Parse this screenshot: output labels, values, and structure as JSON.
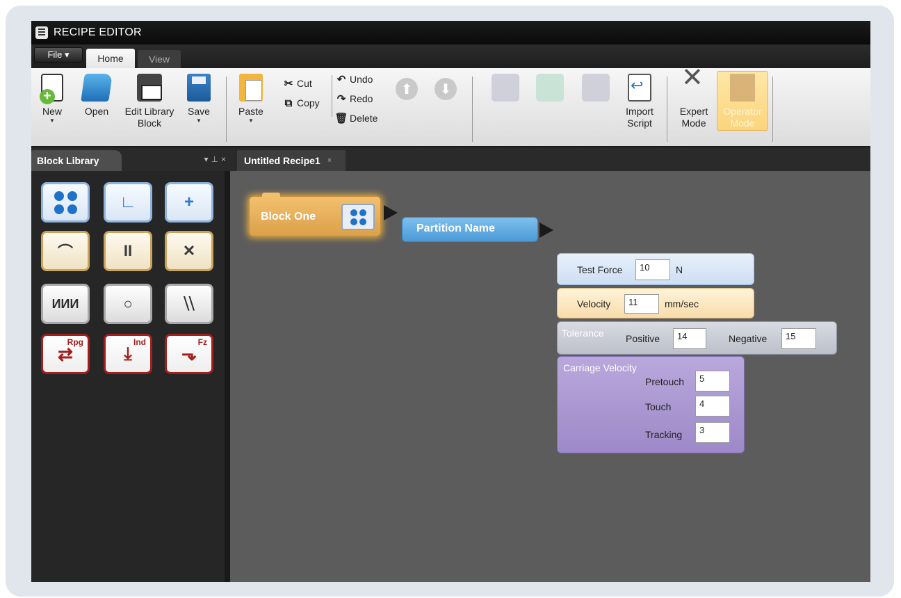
{
  "window": {
    "title": "RECIPE EDITOR"
  },
  "menu": {
    "file": "File ▾",
    "tabs": [
      "Home",
      "View"
    ]
  },
  "ribbon": {
    "new": "New",
    "open": "Open",
    "edit_library_block": "Edit Library Block",
    "save": "Save",
    "paste": "Paste",
    "cut": "Cut",
    "copy": "Copy",
    "undo": "Undo",
    "redo": "Redo",
    "delete": "Delete",
    "import_script": "Import Script",
    "expert_mode": "Expert Mode",
    "operator_mode": "Operator Mode"
  },
  "library": {
    "title": "Block Library"
  },
  "document": {
    "tab": "Untitled Recipe1"
  },
  "blocks": {
    "block_one": "Block One",
    "partition_name": "Partition Name",
    "test_force": {
      "label": "Test Force",
      "value": "10",
      "unit": "N"
    },
    "velocity": {
      "label": "Velocity",
      "value": "11",
      "unit": "mm/sec"
    },
    "tolerance": {
      "label": "Tolerance",
      "positive_label": "Positive",
      "positive": "14",
      "negative_label": "Negative",
      "negative": "15"
    },
    "carriage": {
      "label": "Carriage Velocity",
      "pretouch_label": "Pretouch",
      "pretouch": "5",
      "touch_label": "Touch",
      "touch": "4",
      "tracking_label": "Tracking",
      "tracking": "3"
    }
  },
  "palette": {
    "row4_sup": [
      "Rpg",
      "Ind",
      "Fz"
    ]
  },
  "colors": {
    "block_gold": "#e5ad55",
    "block_blue": "#5aa8e2",
    "operator_mode": "#fcd47c",
    "accent_red": "#a51d1d"
  }
}
